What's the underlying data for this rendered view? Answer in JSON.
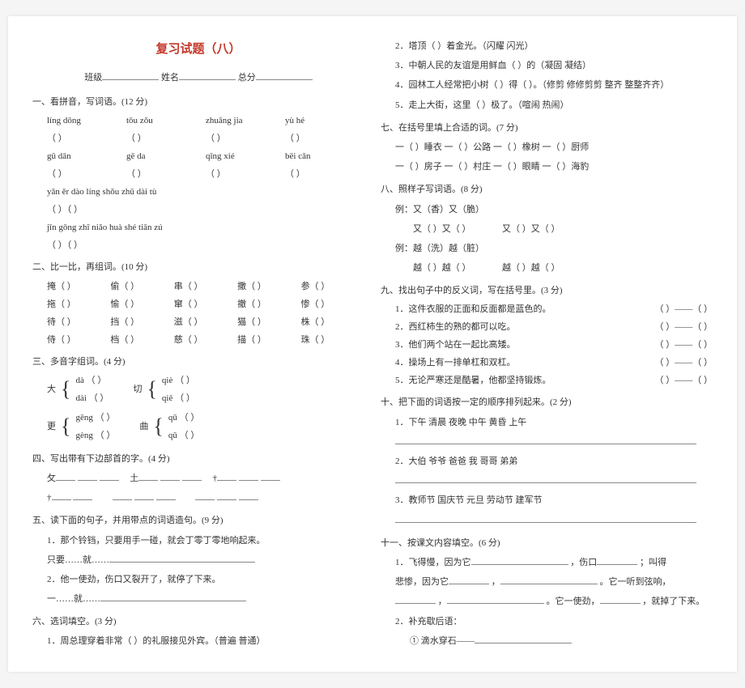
{
  "title": "复习试题（八）",
  "info": {
    "class": "班级",
    "name": "姓名",
    "score": "总分"
  },
  "s1": {
    "head": "一、看拼音，写词语。(12 分)",
    "r1": [
      "líng dōng",
      "tōu zǒu",
      "zhuāng jia",
      "yù hé"
    ],
    "r2": [
      "gū dān",
      "gē da",
      "qīng xié",
      "bēi cǎn"
    ],
    "r3": "yǎn ěr dào líng  shǒu zhū dài tù",
    "r4": "jīn gōng zhī niǎo huà shé tiān zú"
  },
  "s2": {
    "head": "二、比一比，再组词。(10 分)",
    "rows": [
      [
        "掩（   ）",
        "偷（   ）",
        "串（   ）",
        "撒（   ）",
        "参（   ）"
      ],
      [
        "拖（   ）",
        "愉（   ）",
        "窜（   ）",
        "撤（   ）",
        "惨（   ）"
      ],
      [
        "待（   ）",
        "挡（   ）",
        "滋（   ）",
        "猫（   ）",
        "株（   ）"
      ],
      [
        "侍（   ）",
        "档（   ）",
        "慈（   ）",
        "描（   ）",
        "珠（   ）"
      ]
    ]
  },
  "s3": {
    "head": "三、多音字组词。(4 分)",
    "g1": {
      "ch": "大",
      "a": "dà",
      "b": "dài"
    },
    "g2": {
      "ch": "切",
      "a": "qiè",
      "b": "qiē"
    },
    "g3": {
      "ch": "更",
      "a": "gēng",
      "b": "gèng"
    },
    "g4": {
      "ch": "曲",
      "a": "qū",
      "b": "qǔ"
    }
  },
  "s4": {
    "head": "四、写出带有下边部首的字。(4 分)",
    "items": [
      "攵",
      "土",
      "†",
      "†"
    ]
  },
  "s5": {
    "head": "五、读下面的句子，并用带点的词语造句。(9 分)",
    "q1": "1．那个铃铛，只要用手一碰，就会丁零丁零地响起来。",
    "q1p": "只要……就……",
    "q2": "2．他一使劲，伤口又裂开了，就停了下来。",
    "q2p": "一……就……"
  },
  "s6": {
    "head": "六、选词填空。(3 分)",
    "q1": "1．周总理穿着非常（        ）的礼服接见外宾。（普遍  普通）"
  },
  "r": {
    "q2": "2．塔顶（        ）着金光。（闪耀  闪光）",
    "q3": "3．中朝人民的友谊是用鲜血（        ）的（凝固  凝结）",
    "q4": "4．园林工人经常把小树（        ）得（        ）。（修剪  修修剪剪  整齐  整整齐齐）",
    "q5": "5．走上大街，这里（        ）极了。（喧闹  热闹）"
  },
  "s7": {
    "head": "七、在括号里填上合适的词。(7 分)",
    "l1": "一（    ）睡衣  一（    ）公路  一（    ）橡树  一（    ）厨师",
    "l2": "一（    ）房子  一（    ）村庄  一（    ）眼睛  一（    ）海豹"
  },
  "s8": {
    "head": "八、照样子写词语。(8 分)",
    "e1": "例：又（香）又（脆）",
    "l1a": "又（   ）又（   ）",
    "l1b": "又（   ）又（   ）",
    "e2": "例：越（洗）越（脏）",
    "l2a": "越（   ）越（   ）",
    "l2b": "越（   ）越（   ）"
  },
  "s9": {
    "head": "九、找出句子中的反义词，写在括号里。(3 分)",
    "items": [
      "1．这件衣服的正面和反面都是蓝色的。",
      "2．西红柿生的熟的都可以吃。",
      "3．他们两个站在一起比高矮。",
      "4．操场上有一排单杠和双杠。",
      "5．无论严寒还是酷暑，他都坚持锻炼。"
    ],
    "tail": "（      ）——（      ）"
  },
  "s10": {
    "head": "十、把下面的词语按一定的顺序排列起来。(2 分)",
    "items": [
      "1．下午  清晨  夜晚  中午  黄昏  上午",
      "2．大伯  爷爷  爸爸  我  哥哥  弟弟",
      "3．教师节  国庆节  元旦  劳动节  建军节"
    ]
  },
  "s11": {
    "head": "十一、按课文内容填空。(6 分)",
    "l1a": "1．飞得慢，因为它",
    "l1b": "，伤口",
    "l1c": "；叫得",
    "l2a": "悲惨，因为它",
    "l2b": "，",
    "l2c": "。它一听到弦响，",
    "l3a": "，",
    "l3b": "。它一使劲，",
    "l3c": "，就掉了下来。",
    "l4": "2．补充歇后语：",
    "l5": "①  滴水穿石——"
  }
}
